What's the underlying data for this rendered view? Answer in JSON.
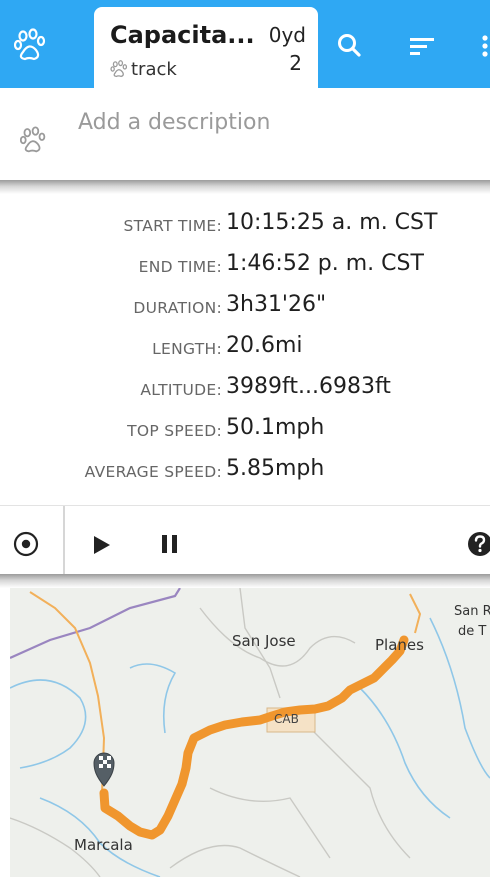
{
  "app": {
    "title": "Capacita...",
    "subtype": "track",
    "count_top": "0yd",
    "count_bottom": "2"
  },
  "toolbar": {
    "icons": [
      "paw-icon",
      "search-icon",
      "sort-icon",
      "more-icon"
    ]
  },
  "description": {
    "placeholder": "Add a description"
  },
  "stats": [
    {
      "label": "START TIME:",
      "value": "10:15:25 a. m. CST"
    },
    {
      "label": "END TIME:",
      "value": "1:46:52 p. m. CST"
    },
    {
      "label": "DURATION:",
      "value": "3h31'26\""
    },
    {
      "label": "LENGTH:",
      "value": "20.6mi"
    },
    {
      "label": "ALTITUDE:",
      "value": "3989ft...6983ft"
    },
    {
      "label": "TOP SPEED:",
      "value": "50.1mph"
    },
    {
      "label": "AVERAGE SPEED:",
      "value": "5.85mph"
    }
  ],
  "controls": {
    "icons": [
      "locate-icon",
      "play-icon",
      "pause-icon",
      "help-icon"
    ]
  },
  "map": {
    "labels": {
      "san_jose": "San Jose",
      "planes": "Planes",
      "san_r": "San R",
      "de_t": "de T",
      "marcala": "Marcala",
      "town": "CAB"
    },
    "track_color": "#f0962e",
    "marker": "checkered-flag-marker"
  },
  "colors": {
    "accent": "#2fa8f3",
    "track": "#f0962e"
  }
}
